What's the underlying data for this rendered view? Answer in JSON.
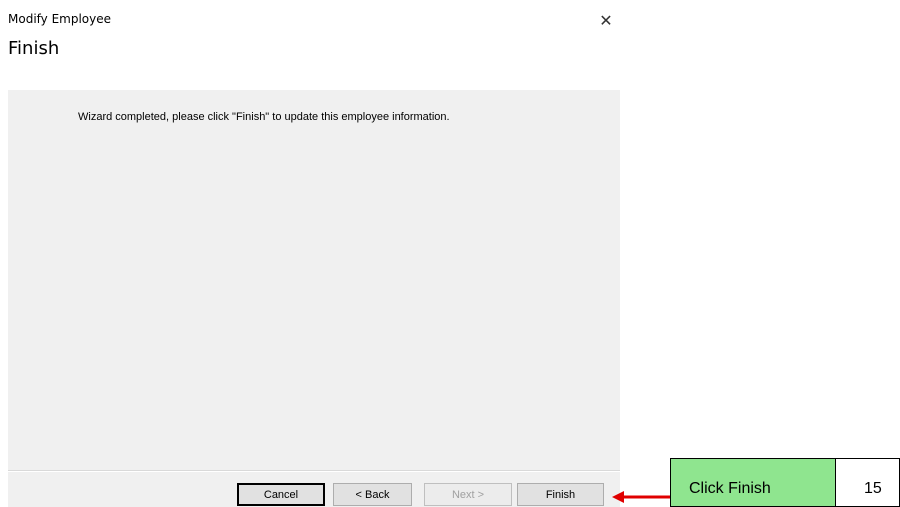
{
  "window": {
    "title": "Modify Employee",
    "close_glyph": "✕",
    "close_icon": "close-icon"
  },
  "header": {
    "page_title": "Finish"
  },
  "content": {
    "message": "Wizard completed, please click \"Finish\" to update this employee information."
  },
  "buttons": {
    "cancel": "Cancel",
    "back": "< Back",
    "next": "Next >",
    "finish": "Finish"
  },
  "annotation": {
    "label": "Click Finish",
    "step": "15",
    "arrow_color": "#e00000",
    "box_color": "#8fe58f",
    "arrow_icon": "left-arrow-icon"
  }
}
